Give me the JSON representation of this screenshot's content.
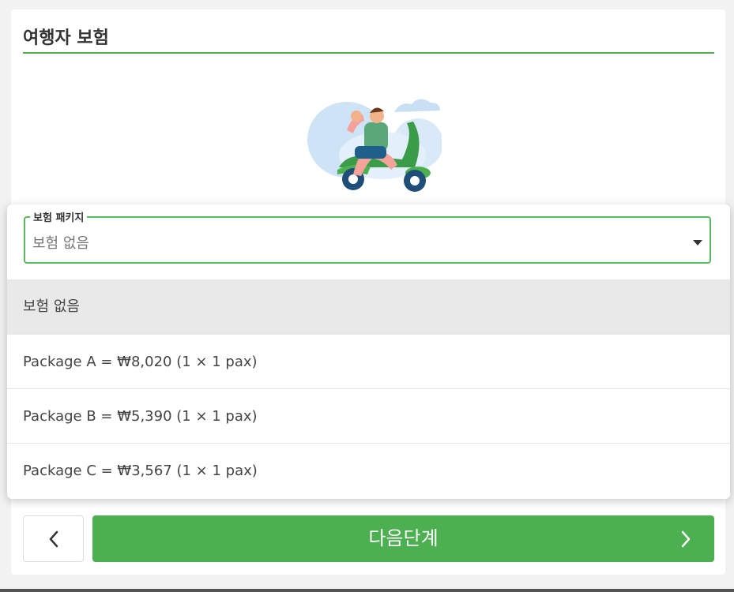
{
  "section": {
    "title": "여행자 보험"
  },
  "select": {
    "legend": "보험 패키지",
    "selected_value": "보험 없음"
  },
  "options": [
    {
      "label": "보험 없음",
      "selected": true
    },
    {
      "label": "Package A = ₩8,020 (1 × 1 pax)",
      "selected": false
    },
    {
      "label": "Package B = ₩5,390 (1 × 1 pax)",
      "selected": false
    },
    {
      "label": "Package C = ₩3,567 (1 × 1 pax)",
      "selected": false
    }
  ],
  "footer": {
    "back_icon": "chevron-left-icon",
    "next_label": "다음단계",
    "next_icon": "chevron-right-icon"
  },
  "colors": {
    "accent": "#4caf50",
    "focus_border": "#5cb85c",
    "selected_bg": "#e9e9e9"
  }
}
